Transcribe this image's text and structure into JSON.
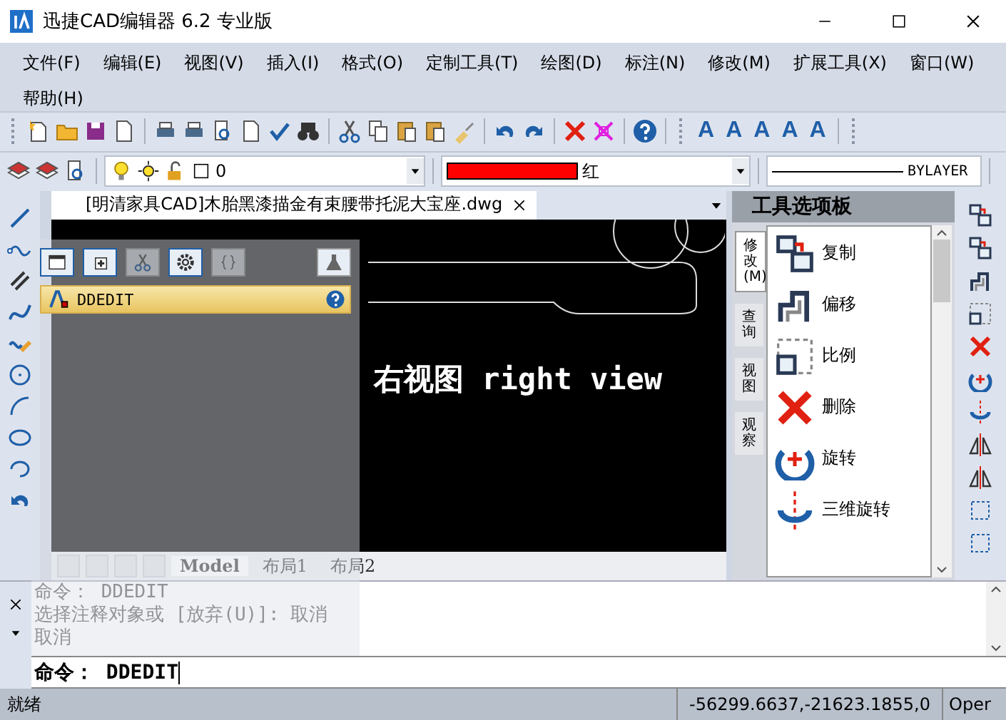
{
  "window": {
    "title": "迅捷CAD编辑器 6.2 专业版"
  },
  "menu": [
    "文件(F)",
    "编辑(E)",
    "视图(V)",
    "插入(I)",
    "格式(O)",
    "定制工具(T)",
    "绘图(D)",
    "标注(N)",
    "修改(M)",
    "扩展工具(X)",
    "窗口(W)",
    "帮助(H)"
  ],
  "text_tools": [
    "A",
    "A",
    "A",
    "A",
    "A"
  ],
  "properties_bar": {
    "layer": "0",
    "color_label": "红",
    "color": "#ff0000",
    "linetype": "BYLAYER"
  },
  "document_tab": {
    "title": "[明清家具CAD]木胎黑漆描金有束腰带托泥大宝座.dwg"
  },
  "canvas": {
    "label": "右视图 right view"
  },
  "layout_tabs": [
    {
      "label": "Model",
      "selected": true
    },
    {
      "label": "布局1",
      "selected": false
    },
    {
      "label": "布局2",
      "selected": false
    }
  ],
  "floating_panel": {
    "command": "DDEDIT"
  },
  "tool_palette": {
    "title": "工具选项板",
    "tabs": [
      {
        "label": "修改(M)",
        "selected": true
      },
      {
        "label": "查询",
        "selected": false
      },
      {
        "label": "视图",
        "selected": false
      },
      {
        "label": "观察",
        "selected": false
      }
    ],
    "items": [
      {
        "kind": "copy",
        "label": "复制"
      },
      {
        "kind": "offset",
        "label": "偏移"
      },
      {
        "kind": "scale",
        "label": "比例"
      },
      {
        "kind": "erase",
        "label": "删除"
      },
      {
        "kind": "rotate",
        "label": "旋转"
      },
      {
        "kind": "rotate3d",
        "label": "三维旋转"
      }
    ]
  },
  "command_line": {
    "history": [
      "命令：  DDEDIT",
      "选择注释对象或 [放弃(U)]: 取消",
      "取消"
    ],
    "input": "命令：  DDEDIT"
  },
  "status_bar": {
    "message": "就绪",
    "coordinates": "-56299.6637,-21623.1855,0",
    "mode": "Oper"
  }
}
